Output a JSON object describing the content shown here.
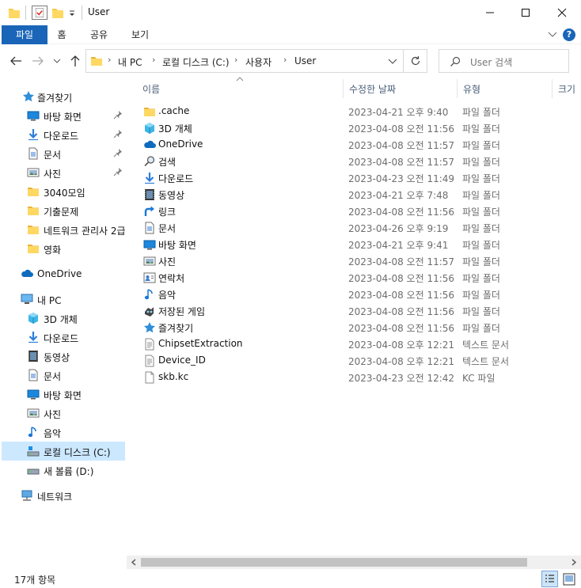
{
  "window": {
    "title": "User",
    "minimize_glyph": "—",
    "maximize_glyph": "☐",
    "close_glyph": "✕"
  },
  "ribbon": {
    "tabs": [
      {
        "label": "파일"
      },
      {
        "label": "홈"
      },
      {
        "label": "공유"
      },
      {
        "label": "보기"
      }
    ],
    "help_glyph": "?",
    "collapse_glyph": "⌵"
  },
  "address": {
    "breadcrumbs": [
      "내 PC",
      "로컬 디스크 (C:)",
      "사용자",
      "User"
    ],
    "search_placeholder": "User 검색"
  },
  "nav": {
    "items": [
      {
        "label": "즐겨찾기",
        "icon": "star-icon"
      },
      {
        "label": "바탕 화면",
        "icon": "desktop-icon",
        "pinned": true
      },
      {
        "label": "다운로드",
        "icon": "download-icon",
        "pinned": true
      },
      {
        "label": "문서",
        "icon": "document-icon",
        "pinned": true
      },
      {
        "label": "사진",
        "icon": "pictures-icon",
        "pinned": true
      },
      {
        "label": "3040모임",
        "icon": "folder-icon"
      },
      {
        "label": "기출문제",
        "icon": "folder-icon"
      },
      {
        "label": "네트워크 관리사 2급",
        "icon": "folder-icon"
      },
      {
        "label": "영화",
        "icon": "folder-icon"
      },
      {
        "label": "OneDrive",
        "icon": "cloud-icon"
      },
      {
        "label": "내 PC",
        "icon": "pc-icon"
      },
      {
        "label": "3D 개체",
        "icon": "3d-objects-icon"
      },
      {
        "label": "다운로드",
        "icon": "download-icon"
      },
      {
        "label": "동영상",
        "icon": "video-icon"
      },
      {
        "label": "문서",
        "icon": "document-icon"
      },
      {
        "label": "바탕 화면",
        "icon": "desktop-icon"
      },
      {
        "label": "사진",
        "icon": "pictures-icon"
      },
      {
        "label": "음악",
        "icon": "music-icon"
      },
      {
        "label": "로컬 디스크 (C:)",
        "icon": "drive-c-icon",
        "selected": true
      },
      {
        "label": "새 볼륨 (D:)",
        "icon": "drive-icon"
      },
      {
        "label": "네트워크",
        "icon": "network-icon"
      }
    ]
  },
  "columns": {
    "name": "이름",
    "modified": "수정한 날짜",
    "type": "유형",
    "size": "크기"
  },
  "files": [
    {
      "name": ".cache",
      "modified": "2023-04-21 오후 9:40",
      "type": "파일 폴더",
      "icon": "folder-icon"
    },
    {
      "name": "3D 개체",
      "modified": "2023-04-08 오전 11:56",
      "type": "파일 폴더",
      "icon": "3d-objects-icon"
    },
    {
      "name": "OneDrive",
      "modified": "2023-04-08 오전 11:57",
      "type": "파일 폴더",
      "icon": "cloud-icon"
    },
    {
      "name": "검색",
      "modified": "2023-04-08 오전 11:57",
      "type": "파일 폴더",
      "icon": "search-icon"
    },
    {
      "name": "다운로드",
      "modified": "2023-04-23 오전 11:49",
      "type": "파일 폴더",
      "icon": "download-icon"
    },
    {
      "name": "동영상",
      "modified": "2023-04-21 오후 7:48",
      "type": "파일 폴더",
      "icon": "video-icon"
    },
    {
      "name": "링크",
      "modified": "2023-04-08 오전 11:56",
      "type": "파일 폴더",
      "icon": "link-icon"
    },
    {
      "name": "문서",
      "modified": "2023-04-26 오후 9:19",
      "type": "파일 폴더",
      "icon": "document-icon"
    },
    {
      "name": "바탕 화면",
      "modified": "2023-04-21 오후 9:41",
      "type": "파일 폴더",
      "icon": "desktop-icon"
    },
    {
      "name": "사진",
      "modified": "2023-04-08 오전 11:57",
      "type": "파일 폴더",
      "icon": "pictures-icon"
    },
    {
      "name": "연락처",
      "modified": "2023-04-08 오전 11:56",
      "type": "파일 폴더",
      "icon": "contacts-icon"
    },
    {
      "name": "음악",
      "modified": "2023-04-08 오전 11:56",
      "type": "파일 폴더",
      "icon": "music-icon"
    },
    {
      "name": "저장된 게임",
      "modified": "2023-04-08 오전 11:56",
      "type": "파일 폴더",
      "icon": "saved-games-icon"
    },
    {
      "name": "즐겨찾기",
      "modified": "2023-04-08 오전 11:56",
      "type": "파일 폴더",
      "icon": "star-icon"
    },
    {
      "name": "ChipsetExtraction",
      "modified": "2023-04-08 오후 12:21",
      "type": "텍스트 문서",
      "icon": "text-file-icon"
    },
    {
      "name": "Device_ID",
      "modified": "2023-04-08 오후 12:21",
      "type": "텍스트 문서",
      "icon": "text-file-icon"
    },
    {
      "name": "skb.kc",
      "modified": "2023-04-23 오전 12:42",
      "type": "KC 파일",
      "icon": "file-icon"
    }
  ],
  "status": {
    "item_count": "17개 항목"
  }
}
